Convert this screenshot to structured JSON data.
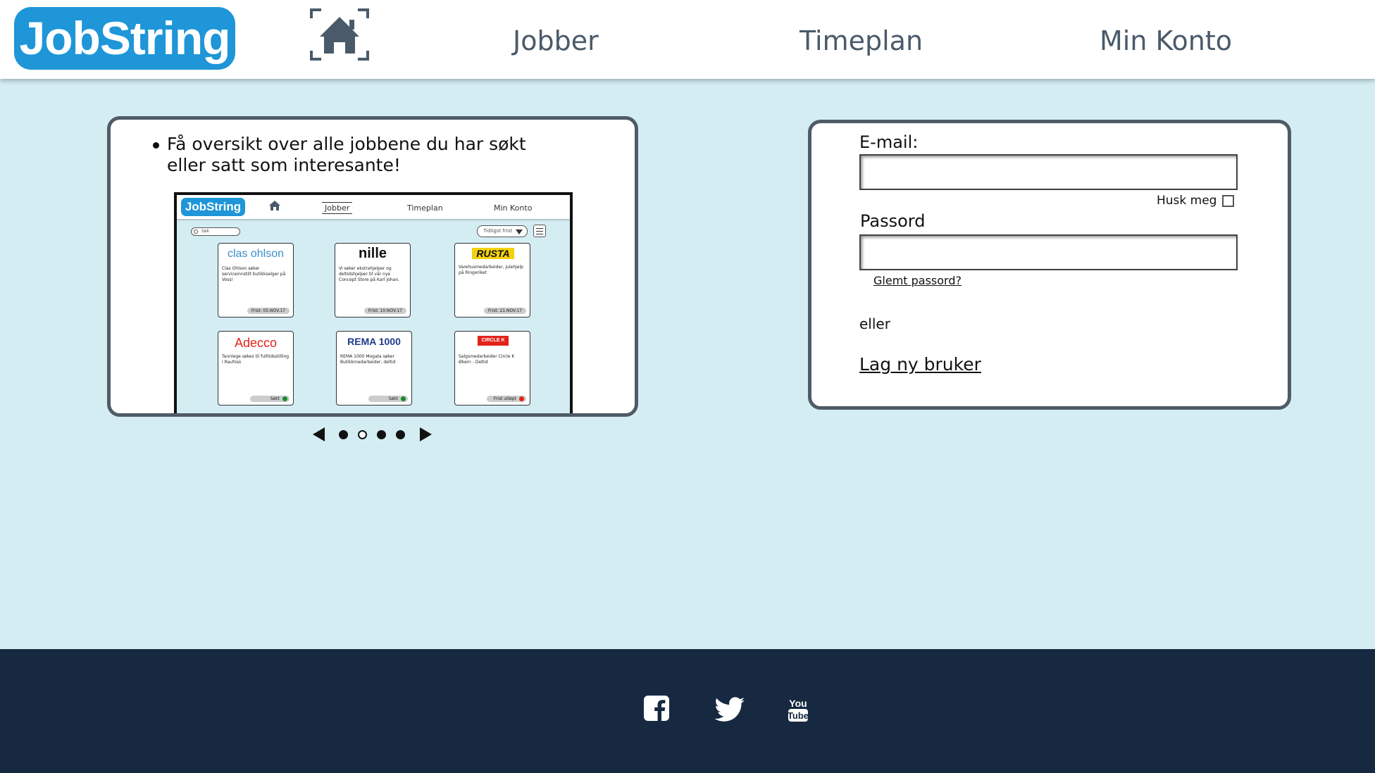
{
  "app": {
    "logo": "JobString"
  },
  "nav": {
    "jobber": "Jobber",
    "timeplan": "Timeplan",
    "min_konto": "Min Konto"
  },
  "carousel": {
    "bullet": "Få oversikt over alle jobbene du har søkt eller satt som interesante!",
    "preview": {
      "logo": "JobString",
      "nav": {
        "jobber": "Jobber",
        "timeplan": "Timeplan",
        "min_konto": "Min Konto"
      },
      "search_placeholder": "Søk",
      "sort_label": "Tidligst frist",
      "cards": [
        {
          "brand": "clas ohlson",
          "text": "Clas Ohlson søker serviceinnstilt butikkselger på Voss!",
          "status": "Frist: 05.NOV.17"
        },
        {
          "brand": "nille",
          "text": "Vi søker ekstrahjelper og deltidshjelper til vår nye Concept Store på Karl Johan.",
          "status": "Frist: 10.NOV.17"
        },
        {
          "brand": "RUSTA",
          "text": "Varehusmedarbeider, julehjelp på Ringeriket",
          "status": "Frist: 21.NOV.17"
        },
        {
          "brand": "Adecco",
          "text": "Tannlege søkes til fulltidsstilling i Raufoss",
          "status": "Søkt"
        },
        {
          "brand": "REMA 1000",
          "text": "REMA 1000 Mogata søker Butikkmedarbeider, deltid",
          "status": "Søkt"
        },
        {
          "brand": "CIRCLE K",
          "text": "Salgsmedarbeider Circle K Økern - Deltid",
          "status": "Frist utløpt"
        }
      ]
    },
    "slides": 4,
    "active_slide": 2
  },
  "login": {
    "email_label": "E-mail:",
    "email_value": "",
    "remember_label": "Husk meg",
    "password_label": "Passord",
    "password_value": "",
    "forgot_link": "Glemt passord?",
    "or_text": "eller",
    "create_link": "Lag ny bruker"
  },
  "footer": {
    "icons": [
      "facebook-icon",
      "twitter-icon",
      "youtube-icon"
    ]
  },
  "colors": {
    "brand": "#1e96d8",
    "background": "#d3edf3",
    "footer": "#162941",
    "border": "#4f5b66"
  }
}
